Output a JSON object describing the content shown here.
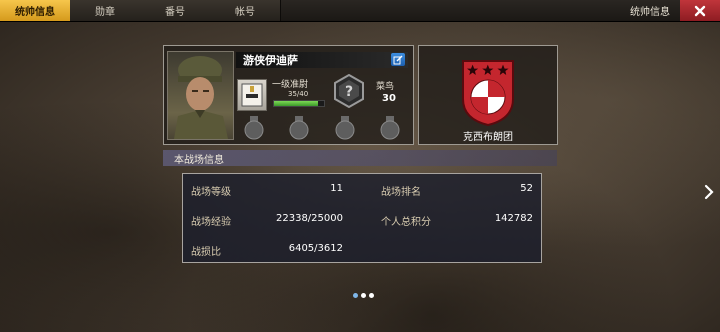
{
  "tabs": [
    {
      "label": "统帅信息",
      "active": true
    },
    {
      "label": "勋章",
      "active": false
    },
    {
      "label": "番号",
      "active": false
    },
    {
      "label": "帐号",
      "active": false
    }
  ],
  "header": {
    "title": "统帅信息",
    "close_icon": "close-icon"
  },
  "player": {
    "name": "游侠伊迪萨",
    "rank": "一级准尉",
    "exp": "35/40",
    "exp_fraction": 0.875,
    "veteran_label": "菜鸟",
    "veteran_value": "30",
    "medal_slots": 4
  },
  "legion": {
    "name": "克西布朗团",
    "stars": 3,
    "color": "#c4262e"
  },
  "battlefield": {
    "title": "本战场信息",
    "stats": {
      "level_label": "战场等级",
      "level_value": "11",
      "rank_label": "战场排名",
      "rank_value": "52",
      "exp_label": "战场经验",
      "exp_value": "22338/25000",
      "score_label": "个人总积分",
      "score_value": "142782",
      "ratio_label": "战损比",
      "ratio_value": "6405/3612"
    }
  },
  "pagination": {
    "pages": 3,
    "current": 1
  },
  "colors": {
    "accent": "#f2b93b",
    "close": "#b8262d",
    "exp_bar": "#5cc243"
  }
}
